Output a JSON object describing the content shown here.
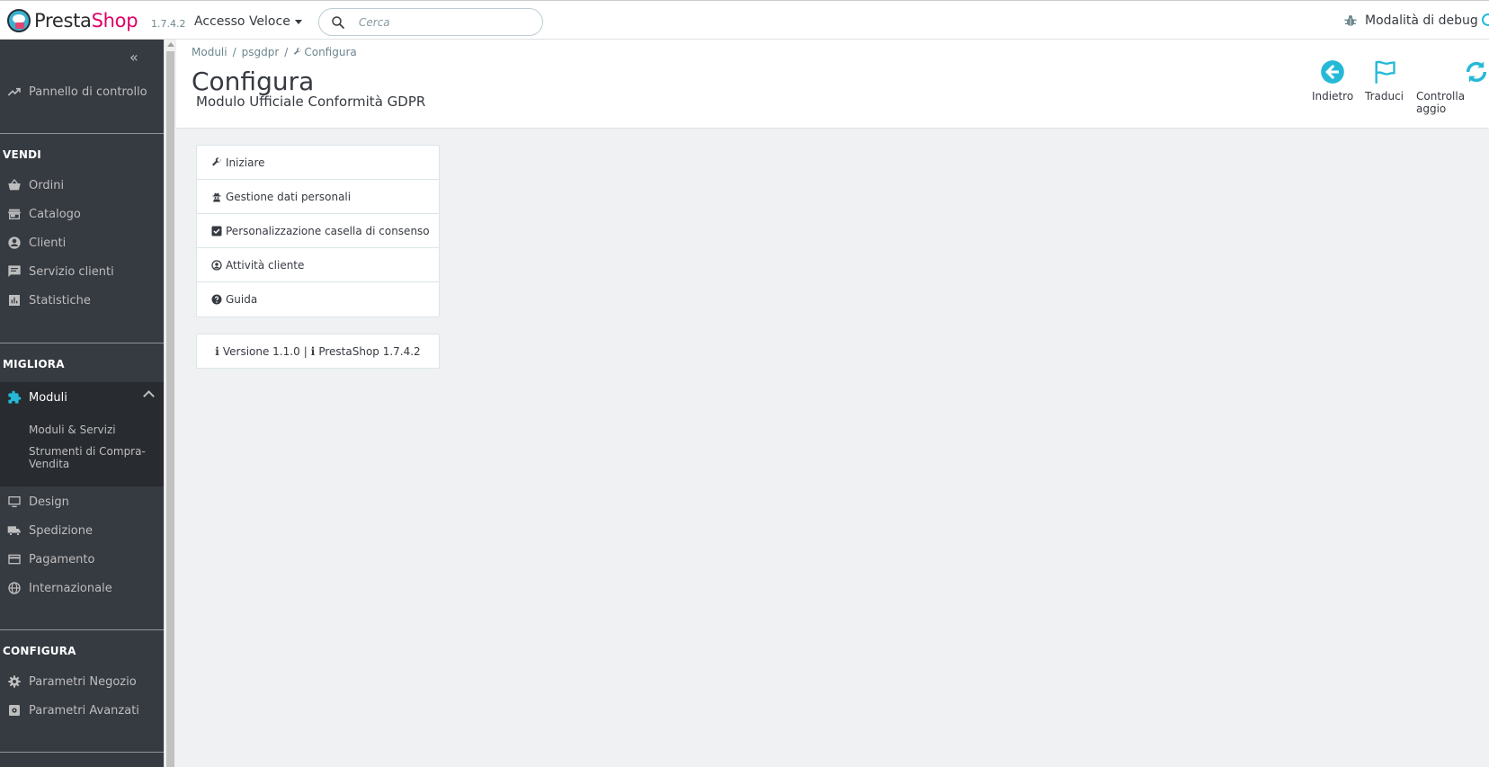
{
  "header": {
    "logo_part1": "Presta",
    "logo_part2": "Shop",
    "version": "1.7.4.2",
    "quick_access": "Accesso Veloce",
    "search_placeholder": "Cerca",
    "debug_label": "Modalità di debug"
  },
  "sidebar": {
    "dashboard": "Pannello di controllo",
    "sections": {
      "sell": "VENDI",
      "improve": "MIGLIORA",
      "configure": "CONFIGURA"
    },
    "sell_items": [
      "Ordini",
      "Catalogo",
      "Clienti",
      "Servizio clienti",
      "Statistiche"
    ],
    "modules": "Moduli",
    "modules_sub": [
      "Moduli & Servizi",
      "Strumenti di Compra-Vendita"
    ],
    "improve_items": [
      "Design",
      "Spedizione",
      "Pagamento",
      "Internazionale"
    ],
    "configure_items": [
      "Parametri Negozio",
      "Parametri Avanzati"
    ]
  },
  "page": {
    "breadcrumb": [
      "Moduli",
      "psgdpr",
      "Configura"
    ],
    "title": "Configura",
    "subtitle": "Modulo Ufficiale Conformità GDPR",
    "toolbar": {
      "back": "Indietro",
      "translate": "Traduci",
      "update": "Controlla aggio"
    }
  },
  "module_menu": [
    "Iniziare",
    "Gestione dati personali",
    "Personalizzazione casella di consenso",
    "Attività cliente",
    "Guida"
  ],
  "version_info": {
    "module": "Versione 1.1.0",
    "separator": "|",
    "platform": "PrestaShop 1.7.4.2"
  },
  "colors": {
    "accent": "#25b9d7",
    "sidebar_bg": "#363a41",
    "brand_pink": "#df0067"
  }
}
